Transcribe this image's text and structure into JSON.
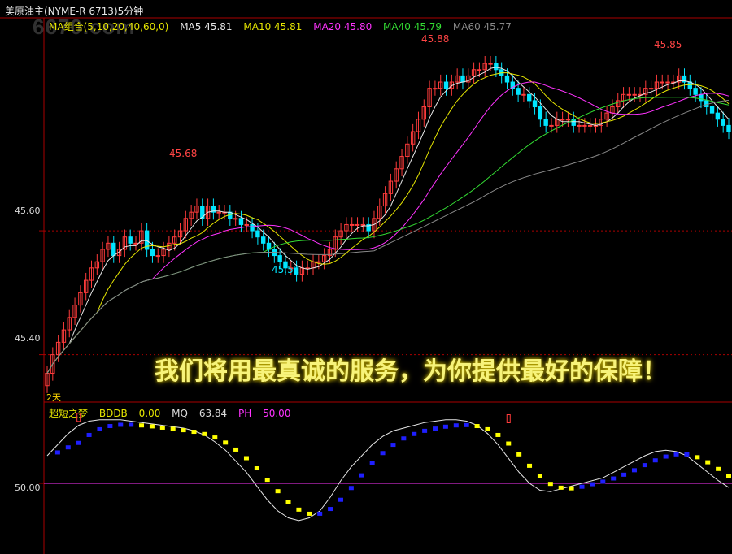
{
  "header": {
    "title": "美原油主(NYME-R 6713)5分钟",
    "watermark": "6670.com",
    "banner": "我们将用最真诚的服务，为你提供最好的保障！"
  },
  "legend": {
    "ma_group": "MA组合(5,10,20,40,60,0)",
    "ma5": "MA5 45.81",
    "ma10": "MA10 45.81",
    "ma20": "MA20 45.80",
    "ma40": "MA40 45.79",
    "ma60": "MA60 45.77"
  },
  "lower_legend": {
    "name": "超短之梦",
    "bddb": "BDDB",
    "bddb_val": "0.00",
    "mq": "MQ",
    "mq_val": "63.84",
    "ph": "PH",
    "ph_val": "50.00"
  },
  "colors": {
    "up": "#ff3b3b",
    "down": "#00e5ff",
    "ma5": "#e6e6e6",
    "ma10": "#e6e600",
    "ma20": "#ff33ff",
    "ma40": "#33dd33",
    "ma60": "#888888",
    "yellow_bar": "#ffff00",
    "blue_bar": "#1f1fff"
  },
  "chart_data": [
    {
      "type": "candlestick",
      "title": "美原油主(NYME-R 6713)5分钟",
      "ylim": [
        45.33,
        45.92
      ],
      "ticks": [
        "45.40",
        "45.60"
      ],
      "annotations": [
        "45.68",
        "45.52",
        "45.88",
        "45.85",
        "2天"
      ],
      "x": [
        0,
        1,
        2,
        3,
        4,
        5,
        6,
        7,
        8,
        9,
        10,
        11,
        12,
        13,
        14,
        15,
        16,
        17,
        18,
        19,
        20,
        21,
        22,
        23,
        24,
        25,
        26,
        27,
        28,
        29,
        30,
        31,
        32,
        33,
        34,
        35,
        36,
        37,
        38,
        39,
        40,
        41,
        42,
        43,
        44,
        45,
        46,
        47,
        48,
        49,
        50,
        51,
        52,
        53,
        54,
        55,
        56,
        57,
        58,
        59,
        60,
        61,
        62,
        63,
        64,
        65,
        66,
        67,
        68,
        69,
        70,
        71,
        72,
        73,
        74,
        75,
        76,
        77,
        78,
        79,
        80,
        81,
        82,
        83,
        84,
        85,
        86,
        87,
        88,
        89,
        90,
        91,
        92,
        93,
        94,
        95,
        96,
        97,
        98,
        99,
        100,
        101,
        102,
        103,
        104,
        105,
        106,
        107,
        108,
        109,
        110,
        111,
        112,
        113,
        114,
        115,
        116,
        117,
        118,
        119,
        120,
        121,
        122,
        123,
        124,
        125,
        126,
        127,
        128,
        129,
        130,
        131,
        132,
        133,
        134,
        135,
        136,
        137,
        138,
        139,
        140,
        141
      ],
      "close": [
        45.37,
        45.4,
        45.42,
        45.44,
        45.46,
        45.48,
        45.5,
        45.52,
        45.54,
        45.55,
        45.57,
        45.58,
        45.56,
        45.57,
        45.59,
        45.58,
        45.58,
        45.6,
        45.57,
        45.56,
        45.56,
        45.57,
        45.58,
        45.59,
        45.6,
        45.62,
        45.63,
        45.64,
        45.62,
        45.64,
        45.63,
        45.63,
        45.63,
        45.62,
        45.62,
        45.61,
        45.61,
        45.6,
        45.59,
        45.58,
        45.57,
        45.56,
        45.55,
        45.54,
        45.54,
        45.53,
        45.54,
        45.54,
        45.55,
        45.55,
        45.56,
        45.57,
        45.59,
        45.6,
        45.61,
        45.61,
        45.61,
        45.61,
        45.6,
        45.62,
        45.64,
        45.66,
        45.68,
        45.7,
        45.72,
        45.74,
        45.76,
        45.78,
        45.8,
        45.83,
        45.83,
        45.84,
        45.83,
        45.84,
        45.85,
        45.84,
        45.85,
        45.86,
        45.86,
        45.87,
        45.87,
        45.86,
        45.85,
        45.84,
        45.83,
        45.82,
        45.82,
        45.81,
        45.8,
        45.78,
        45.77,
        45.77,
        45.78,
        45.78,
        45.78,
        45.77,
        45.77,
        45.77,
        45.77,
        45.77,
        45.78,
        45.79,
        45.8,
        45.81,
        45.82,
        45.82,
        45.82,
        45.82,
        45.83,
        45.83,
        45.84,
        45.84,
        45.84,
        45.84,
        45.85,
        45.84,
        45.83,
        45.82,
        45.81,
        45.8,
        45.79,
        45.78,
        45.77,
        45.76
      ],
      "series": [
        {
          "name": "MA5",
          "color": "#e6e6e6"
        },
        {
          "name": "MA10",
          "color": "#e6e600"
        },
        {
          "name": "MA20",
          "color": "#ff33ff"
        },
        {
          "name": "MA40",
          "color": "#33dd33"
        },
        {
          "name": "MA60",
          "color": "#888888"
        }
      ]
    },
    {
      "type": "bar",
      "title": "超短之梦",
      "ylim": [
        0,
        100
      ],
      "ticks": [
        "50.00"
      ],
      "series": [
        {
          "name": "MQ",
          "values": [
            70,
            78,
            86,
            92,
            95,
            96,
            96,
            96,
            95,
            94,
            93,
            92,
            91,
            90,
            88,
            85,
            80,
            74,
            66,
            58,
            48,
            38,
            30,
            25,
            23,
            25,
            30,
            40,
            52,
            62,
            70,
            78,
            84,
            88,
            90,
            92,
            94,
            95,
            96,
            96,
            95,
            92,
            86,
            78,
            68,
            58,
            50,
            45,
            44,
            46,
            48,
            50,
            52,
            54,
            58,
            62,
            66,
            70,
            73,
            74,
            73,
            70,
            64,
            58,
            52,
            47
          ]
        },
        {
          "name": "BDDB",
          "values": []
        },
        {
          "name": "PH",
          "values": []
        }
      ]
    }
  ]
}
